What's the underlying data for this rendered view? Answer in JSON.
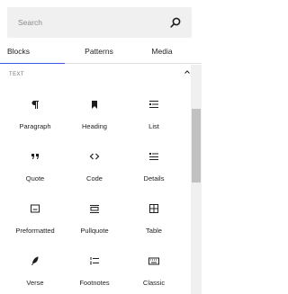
{
  "search": {
    "placeholder": "Search",
    "value": ""
  },
  "tabs": [
    {
      "label": "Blocks",
      "active": true
    },
    {
      "label": "Patterns",
      "active": false
    },
    {
      "label": "Media",
      "active": false
    }
  ],
  "category": {
    "title": "TEXT"
  },
  "blocks": [
    {
      "label": "Paragraph",
      "icon": "paragraph-icon"
    },
    {
      "label": "Heading",
      "icon": "bookmark-icon"
    },
    {
      "label": "List",
      "icon": "list-icon"
    },
    {
      "label": "Quote",
      "icon": "quote-icon"
    },
    {
      "label": "Code",
      "icon": "code-icon"
    },
    {
      "label": "Details",
      "icon": "details-icon"
    },
    {
      "label": "Preformatted",
      "icon": "preformatted-icon"
    },
    {
      "label": "Pullquote",
      "icon": "pullquote-icon"
    },
    {
      "label": "Table",
      "icon": "table-icon"
    },
    {
      "label": "Verse",
      "icon": "verse-icon"
    },
    {
      "label": "Footnotes",
      "icon": "footnotes-icon"
    },
    {
      "label": "Classic",
      "icon": "keyboard-icon"
    }
  ],
  "colors": {
    "accent": "#3858e9",
    "text": "#1e1e1e",
    "muted": "#757575",
    "search_bg": "#f0f0f0"
  }
}
